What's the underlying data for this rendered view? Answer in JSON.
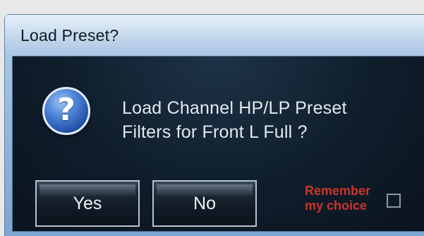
{
  "dialog": {
    "title": "Load Preset?",
    "message_line1": "Load Channel HP/LP Preset",
    "message_line2": "Filters for Front L Full ?",
    "icon": "question-icon",
    "yes_label": "Yes",
    "no_label": "No",
    "remember_line1": "Remember",
    "remember_line2": "my choice",
    "remember_checked": false
  },
  "colors": {
    "remember_text": "#c8362c",
    "client_background": "#0f1d2b",
    "frame": "#8fb3da"
  }
}
